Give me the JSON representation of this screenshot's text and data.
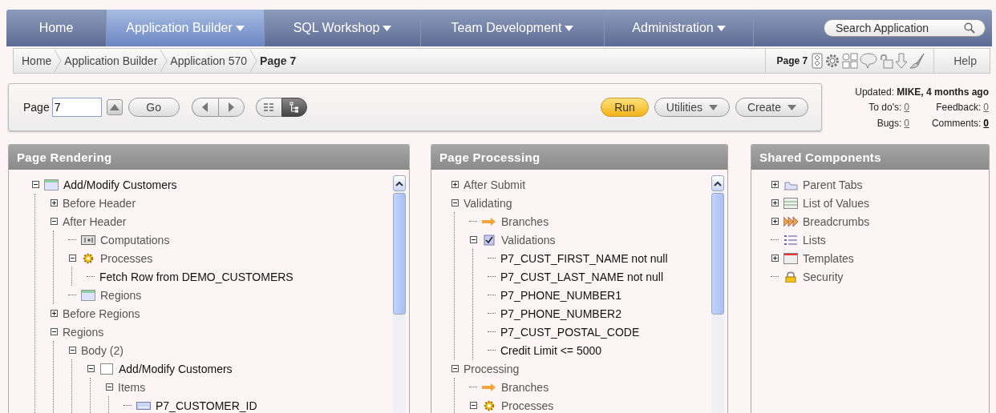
{
  "nav": {
    "tabs": [
      {
        "label": "Home",
        "selected": false,
        "menu": false
      },
      {
        "label": "Application Builder",
        "selected": true,
        "menu": true
      },
      {
        "label": "SQL Workshop",
        "selected": false,
        "menu": true
      },
      {
        "label": "Team Development",
        "selected": false,
        "menu": true
      },
      {
        "label": "Administration",
        "selected": false,
        "menu": true
      }
    ],
    "search": {
      "placeholder": "Search Application"
    }
  },
  "breadcrumb": {
    "items": [
      {
        "label": "Home",
        "current": false
      },
      {
        "label": "Application Builder",
        "current": false
      },
      {
        "label": "Application 570",
        "current": false
      },
      {
        "label": "Page 7",
        "current": true
      }
    ],
    "page_label": "Page 7",
    "help": "Help"
  },
  "toolbar": {
    "page_label": "Page",
    "page_value": "7",
    "go": "Go",
    "views": [
      {
        "kind": "list",
        "selected": false
      },
      {
        "kind": "tree",
        "selected": true
      }
    ],
    "actions": [
      {
        "label": "Run",
        "kind": "primary",
        "menu": false
      },
      {
        "label": "Utilities",
        "kind": "normal",
        "menu": true
      },
      {
        "label": "Create",
        "kind": "normal",
        "menu": true
      }
    ]
  },
  "info": {
    "updated": "Updated: **MIKE, 4 months ago**",
    "counts": [
      {
        "label": "To do's:",
        "value": "0",
        "highlighted": false
      },
      {
        "label": "Feedback:",
        "value": "0",
        "highlighted": false
      },
      {
        "label": "Bugs:",
        "value": "0",
        "highlighted": false
      },
      {
        "label": "Comments:",
        "value": "0",
        "highlighted": true
      }
    ]
  },
  "panels": [
    {
      "title": "Page Rendering",
      "scrollbar": true,
      "tree": [
        {
          "label": "Add/Modify Customers",
          "kind": "page",
          "expanded": true,
          "children": [
            {
              "label": "Before Header",
              "kind": "category",
              "expanded": false
            },
            {
              "label": "After Header",
              "kind": "category",
              "expanded": true,
              "children": [
                {
                  "label": "Computations",
                  "kind": "computation"
                },
                {
                  "label": "Processes",
                  "kind": "process",
                  "expanded": true,
                  "children": [
                    {
                      "label": "Fetch Row from DEMO_CUSTOMERS",
                      "kind": "component"
                    }
                  ]
                },
                {
                  "label": "Regions",
                  "kind": "region"
                }
              ]
            },
            {
              "label": "Before Regions",
              "kind": "category",
              "expanded": false
            },
            {
              "label": "Regions",
              "kind": "category",
              "expanded": true,
              "children": [
                {
                  "label": "Body (2)",
                  "kind": "category",
                  "expanded": true,
                  "children": [
                    {
                      "label": "Add/Modify Customers",
                      "kind": "plain-region",
                      "expanded": true,
                      "children": [
                        {
                          "label": "Items",
                          "kind": "category",
                          "expanded": true,
                          "children": [
                            {
                              "label": "P7_CUSTOMER_ID",
                              "kind": "item"
                            }
                          ]
                        }
                      ]
                    }
                  ]
                }
              ]
            }
          ]
        }
      ]
    },
    {
      "title": "Page Processing",
      "scrollbar": true,
      "tree": [
        {
          "label": "After Submit",
          "kind": "category",
          "expanded": false
        },
        {
          "label": "Validating",
          "kind": "category",
          "expanded": true,
          "children": [
            {
              "label": "Branches",
              "kind": "branch"
            },
            {
              "label": "Validations",
              "kind": "validation",
              "expanded": true,
              "children": [
                {
                  "label": "P7_CUST_FIRST_NAME not null",
                  "kind": "component"
                },
                {
                  "label": "P7_CUST_LAST_NAME not null",
                  "kind": "component"
                },
                {
                  "label": "P7_PHONE_NUMBER1",
                  "kind": "component"
                },
                {
                  "label": "P7_PHONE_NUMBER2",
                  "kind": "component"
                },
                {
                  "label": "P7_CUST_POSTAL_CODE",
                  "kind": "component"
                },
                {
                  "label": "Credit Limit <= 5000",
                  "kind": "component"
                }
              ]
            }
          ]
        },
        {
          "label": "Processing",
          "kind": "category",
          "expanded": true,
          "children": [
            {
              "label": "Branches",
              "kind": "branch"
            },
            {
              "label": "Processes",
              "kind": "process",
              "expanded": true
            }
          ]
        }
      ]
    },
    {
      "title": "Shared Components",
      "scrollbar": false,
      "tree": [
        {
          "label": "Parent Tabs",
          "kind": "tabs",
          "expanded": false
        },
        {
          "label": "List of Values",
          "kind": "lov",
          "expanded": false
        },
        {
          "label": "Breadcrumbs",
          "kind": "breadcrumbs",
          "expanded": false
        },
        {
          "label": "Lists",
          "kind": "lists"
        },
        {
          "label": "Templates",
          "kind": "templates",
          "expanded": false
        },
        {
          "label": "Security",
          "kind": "security"
        }
      ]
    }
  ]
}
